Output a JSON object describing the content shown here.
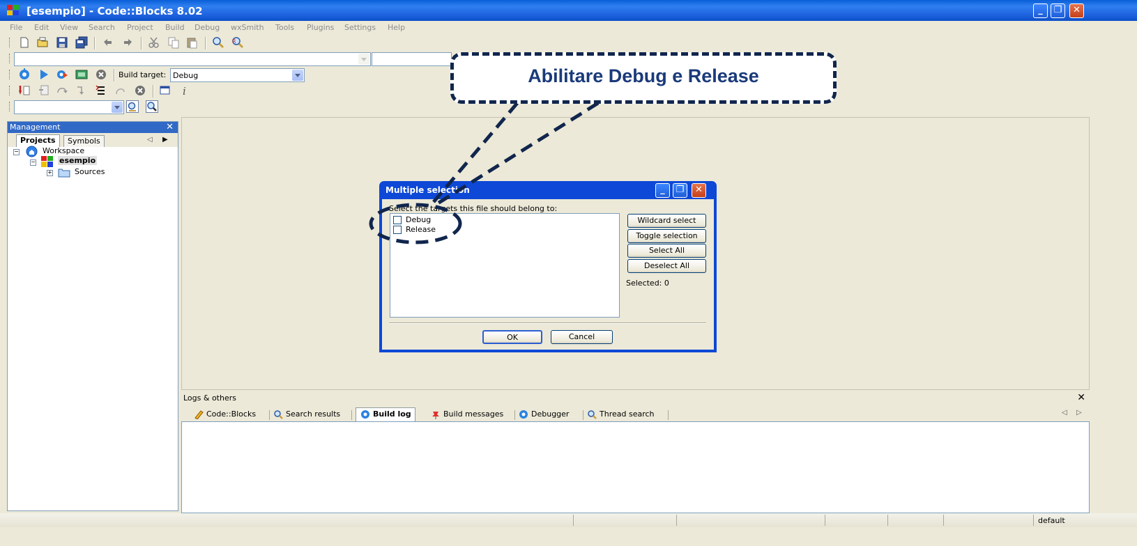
{
  "window": {
    "title": "[esempio] - Code::Blocks 8.02",
    "minimize_label": "_",
    "restore_label": "❐",
    "close_label": "✕"
  },
  "menu": [
    "File",
    "Edit",
    "View",
    "Search",
    "Project",
    "Build",
    "Debug",
    "wxSmith",
    "Tools",
    "Plugins",
    "Settings",
    "Help"
  ],
  "build_toolbar": {
    "build_target_label": "Build target:",
    "build_target_value": "Debug"
  },
  "management": {
    "title": "Management",
    "close_label": "✕",
    "tabs": [
      "Projects",
      "Symbols"
    ],
    "tree": {
      "workspace": "Workspace",
      "project": "esempio",
      "folder": "Sources"
    }
  },
  "logs": {
    "title": "Logs & others",
    "close_label": "✕",
    "tabs": [
      "Code::Blocks",
      "Search results",
      "Build log",
      "Build messages",
      "Debugger",
      "Thread search"
    ],
    "active_tab": "Build log"
  },
  "dialog": {
    "title": "Multiple selection",
    "prompt": "Select the targets this file should belong to:",
    "targets": [
      "Debug",
      "Release"
    ],
    "buttons": {
      "wildcard": "Wildcard select",
      "toggle": "Toggle selection",
      "select_all": "Select All",
      "deselect_all": "Deselect All",
      "ok": "OK",
      "cancel": "Cancel"
    },
    "selected_text": "Selected: 0"
  },
  "callout": {
    "text": "Abilitare Debug e Release"
  },
  "statusbar": {
    "right_text": "default"
  },
  "colors": {
    "titlebar_blue": "#0a5fd8",
    "callout_border": "#11264d",
    "callout_text": "#1a3a7a"
  }
}
